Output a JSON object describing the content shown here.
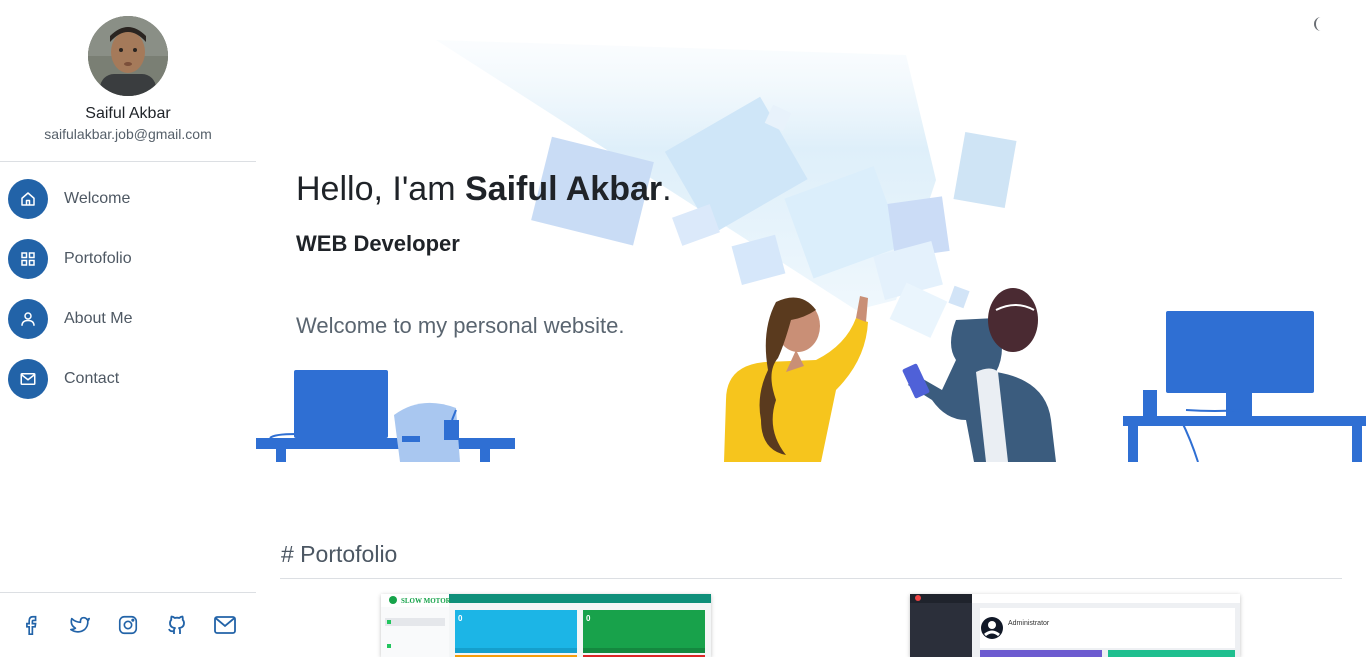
{
  "profile": {
    "name": "Saiful Akbar",
    "email": "saifulakbar.job@gmail.com"
  },
  "nav": [
    {
      "label": "Welcome",
      "icon": "home-icon"
    },
    {
      "label": "Portofolio",
      "icon": "grid-icon"
    },
    {
      "label": "About Me",
      "icon": "user-icon"
    },
    {
      "label": "Contact",
      "icon": "mail-icon"
    }
  ],
  "social": [
    "facebook-icon",
    "twitter-icon",
    "instagram-icon",
    "github-icon",
    "mail-icon"
  ],
  "hero": {
    "greeting": "Hello, I'am ",
    "name": "Saiful Akbar",
    "period": ".",
    "role": "WEB Developer",
    "welcome": "Welcome to my personal website."
  },
  "portfolio": {
    "heading": "# Portofolio",
    "card1": {
      "brand": "SLOW MOTOR",
      "stat1": "0",
      "stat2": "0"
    },
    "card2": {
      "title": "Administrator"
    }
  },
  "colors": {
    "accent": "#2263a8",
    "illustration_blue": "#2f6fd3",
    "text_dark": "#1f2328",
    "text_muted": "#5a6570"
  }
}
